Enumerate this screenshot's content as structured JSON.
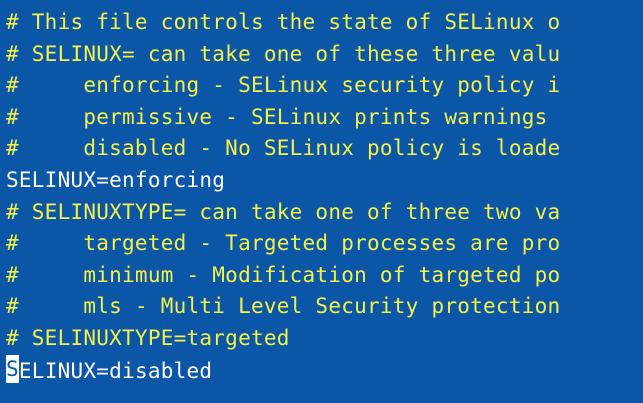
{
  "lines": [
    {
      "kind": "comment",
      "text": "# This file controls the state of SELinux o"
    },
    {
      "kind": "comment",
      "text": "# SELINUX= can take one of these three valu"
    },
    {
      "kind": "comment",
      "text": "#     enforcing - SELinux security policy i"
    },
    {
      "kind": "comment",
      "text": "#     permissive - SELinux prints warnings "
    },
    {
      "kind": "comment",
      "text": "#     disabled - No SELinux policy is loade"
    },
    {
      "kind": "setting",
      "text": "SELINUX=enforcing"
    },
    {
      "kind": "comment",
      "text": "# SELINUXTYPE= can take one of three two va"
    },
    {
      "kind": "comment",
      "text": "#     targeted - Targeted processes are pro"
    },
    {
      "kind": "comment",
      "text": "#     minimum - Modification of targeted po"
    },
    {
      "kind": "comment",
      "text": "#     mls - Multi Level Security protection"
    },
    {
      "kind": "comment",
      "text": "# SELINUXTYPE=targeted"
    }
  ],
  "cursor_line": {
    "cursor_char": "S",
    "rest": "ELINUX=disabled"
  },
  "colors": {
    "background": "#0b56a7",
    "comment": "#f2f24a",
    "setting": "#ffffff",
    "cursor": "#ffffff"
  }
}
